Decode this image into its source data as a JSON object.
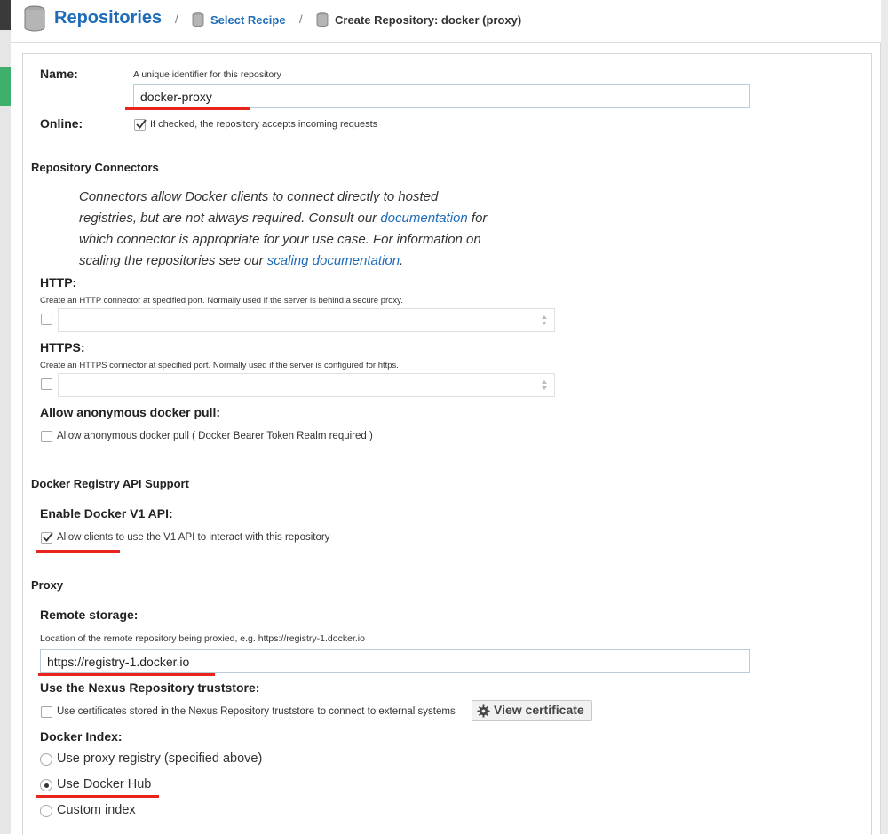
{
  "header": {
    "title": "Repositories",
    "separator": "/",
    "crumb_recipe": "Select Recipe",
    "crumb_current": "Create Repository: docker (proxy)"
  },
  "name": {
    "label": "Name:",
    "help": "A unique identifier for this repository",
    "value": "docker-proxy"
  },
  "online": {
    "label": "Online:",
    "checked": true,
    "help": "If checked, the repository accepts incoming requests"
  },
  "connectors": {
    "section": "Repository Connectors",
    "para_1": "Connectors allow Docker clients to connect directly to hosted",
    "para_2a": "registries, but are not always required. Consult our ",
    "para_2_link": "documentation",
    "para_2b": " for",
    "para_3": "which connector is appropriate for your use case. For information on",
    "para_4a": "scaling the repositories see our ",
    "para_4_link": "scaling documentation",
    "para_4b": ".",
    "http_label": "HTTP:",
    "http_help": "Create an HTTP connector at specified port. Normally used if the server is behind a secure proxy.",
    "https_label": "HTTPS:",
    "https_help": "Create an HTTPS connector at specified port. Normally used if the server is configured for https.",
    "anon_label": "Allow anonymous docker pull:",
    "anon_text": "Allow anonymous docker pull ( Docker Bearer Token Realm required )"
  },
  "api": {
    "section": "Docker Registry API Support",
    "v1_label": "Enable Docker V1 API:",
    "v1_text": "Allow clients to use the V1 API to interact with this repository",
    "v1_checked": true
  },
  "proxy": {
    "section": "Proxy",
    "remote_label": "Remote storage:",
    "remote_help": "Location of the remote repository being proxied, e.g. https://registry-1.docker.io",
    "remote_value": "https://registry-1.docker.io",
    "truststore_label": "Use the Nexus Repository truststore:",
    "truststore_text": "Use certificates stored in the Nexus Repository truststore to connect to external systems",
    "view_cert": "View certificate",
    "index_label": "Docker Index:",
    "index_options": [
      "Use proxy registry (specified above)",
      "Use Docker Hub",
      "Custom index"
    ],
    "index_selected": "Use Docker Hub"
  },
  "colors": {
    "accent": "#1e6bb8",
    "annotation": "#e8251c",
    "input_border": "#b9cdd6"
  }
}
